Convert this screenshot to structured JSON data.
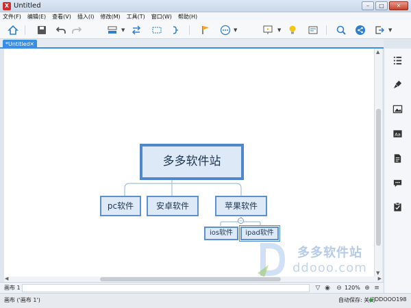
{
  "window": {
    "title": "Untitled",
    "logo_text": "X"
  },
  "menu": [
    "文件(F)",
    "编辑(E)",
    "查看(V)",
    "插入(I)",
    "修改(M)",
    "工具(T)",
    "窗口(W)",
    "帮助(H)"
  ],
  "toolbar_icons": [
    "home-icon",
    "save-icon",
    "undo-icon",
    "redo-icon",
    "topic-icon",
    "relationship-icon",
    "boundary-icon",
    "summary-icon",
    "flag-icon",
    "more-icon",
    "presentation-icon",
    "idea-icon",
    "outline-icon",
    "search-icon",
    "share-icon",
    "export-icon"
  ],
  "tab": {
    "label": "*Untitled",
    "close": "✕"
  },
  "mindmap": {
    "root": "多多软件站",
    "main_topics": [
      "pc软件",
      "安卓软件",
      "苹果软件"
    ],
    "sub_topics": [
      "ios软件",
      "ipad软件"
    ],
    "collapse_symbol": "−"
  },
  "watermark": {
    "text": "多多软件站",
    "url": "ddooo.com"
  },
  "sheetbar": {
    "sheet_tab": "画布 1",
    "zoom": "120%"
  },
  "status": {
    "left": "画布 ('画布 1')",
    "autosave": "自动保存: 关闭",
    "user": "DDOOO198"
  },
  "right_panel_icons": [
    "outline-icon",
    "format-icon",
    "image-icon",
    "text-style-icon",
    "notes-icon",
    "comments-icon",
    "task-icon"
  ]
}
